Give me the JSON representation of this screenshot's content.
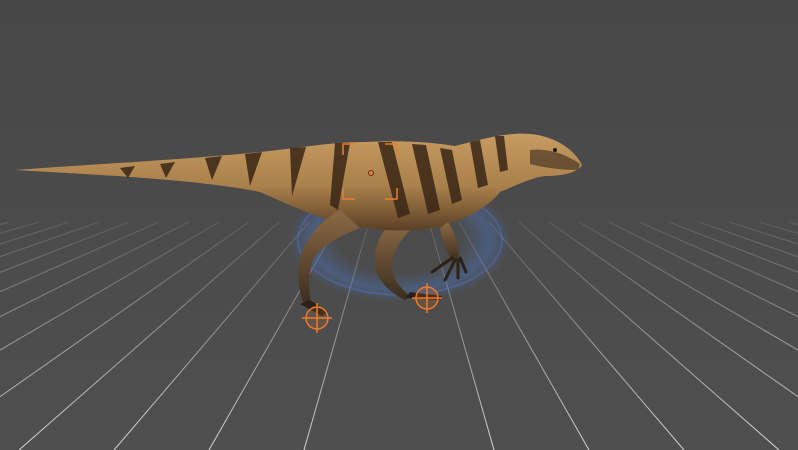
{
  "viewport": {
    "background": "#4b4b4b",
    "grid_color": "#cfcfcf"
  },
  "creature": {
    "kind": "theropod-dinosaur",
    "body_color": "#b58a55",
    "stripe_color": "#3a2616"
  },
  "controls": {
    "accent_color": "#f07a2a",
    "balance_ring_color": "#4a7bd6",
    "items": [
      {
        "name": "body-selection-box",
        "icon": "square-bracket-icon"
      },
      {
        "name": "left-foot-handle",
        "icon": "crosshair-icon"
      },
      {
        "name": "right-foot-handle",
        "icon": "crosshair-icon"
      }
    ]
  }
}
